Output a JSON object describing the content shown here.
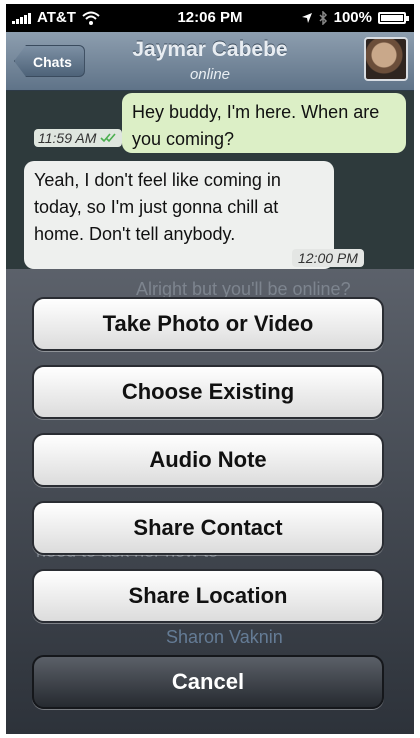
{
  "status_bar": {
    "carrier": "AT&T",
    "time": "12:06 PM",
    "battery": "100%"
  },
  "nav": {
    "back_label": "Chats",
    "contact_name": "Jaymar Cabebe",
    "contact_status": "online"
  },
  "messages": [
    {
      "text": "Hey buddy, I'm here. When are you coming?",
      "time": "11:59 AM",
      "direction": "outgoing"
    },
    {
      "text": "Yeah, I don't feel like coming in today, so I'm just gonna chill at home. Don't tell anybody.",
      "time": "12:00 PM",
      "direction": "incoming"
    }
  ],
  "background_text": {
    "ghost1": "Alright but you'll be online?",
    "ghost2": "need to ask her how to",
    "ghost3": "Sharon Vaknin"
  },
  "action_sheet": {
    "options": [
      "Take Photo or Video",
      "Choose Existing",
      "Audio Note",
      "Share Contact",
      "Share Location"
    ],
    "cancel_label": "Cancel"
  },
  "colors": {
    "nav_bar": "#6f8296",
    "outgoing_bubble": "#dcefc6",
    "incoming_bubble": "#eef0ee",
    "cancel_button": "#3a3f46"
  }
}
